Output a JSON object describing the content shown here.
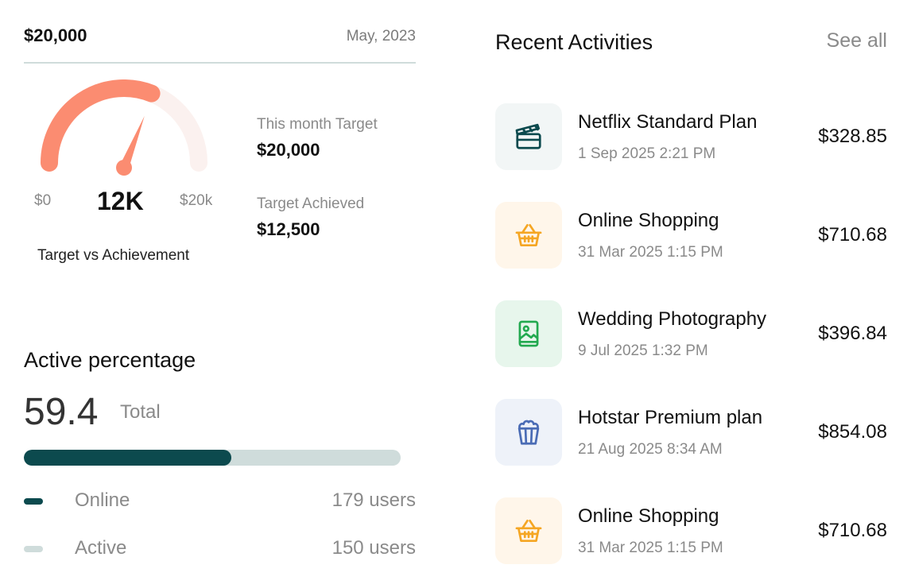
{
  "target": {
    "amount": "$20,000",
    "date": "May, 2023",
    "gauge": {
      "min_label": "$0",
      "max_label": "$20k",
      "value_label": "12K",
      "caption": "Target vs Achievement",
      "progress_fraction": 0.62,
      "color_progress": "#fb8c71",
      "color_remaining": "#fbf1ef"
    },
    "month_target_label": "This month Target",
    "month_target_value": "$20,000",
    "achieved_label": "Target Achieved",
    "achieved_value": "$12,500"
  },
  "active": {
    "title": "Active percentage",
    "value": "59.4",
    "total_label": "Total",
    "bar_fill_percent": 55,
    "legend": [
      {
        "label": "Online",
        "count": "179 users",
        "color": "#0c4a4e"
      },
      {
        "label": "Active",
        "count": "150 users",
        "color": "#cfdcdb"
      }
    ]
  },
  "recent": {
    "title": "Recent Activities",
    "see_all": "See all",
    "items": [
      {
        "name": "Netflix Standard Plan",
        "time": "1 Sep 2025 2:21 PM",
        "amount": "$328.85",
        "icon": "clapperboard-icon",
        "bg": "#f2f6f6",
        "fg": "#0c4a4e"
      },
      {
        "name": "Online Shopping",
        "time": "31 Mar 2025 1:15 PM",
        "amount": "$710.68",
        "icon": "basket-icon",
        "bg": "#fff6ea",
        "fg": "#f5a623"
      },
      {
        "name": "Wedding Photography",
        "time": "9 Jul 2025 1:32 PM",
        "amount": "$396.84",
        "icon": "image-icon",
        "bg": "#e7f6ec",
        "fg": "#22a94f"
      },
      {
        "name": "Hotstar Premium plan",
        "time": "21 Aug 2025 8:34 AM",
        "amount": "$854.08",
        "icon": "popcorn-icon",
        "bg": "#eef2f9",
        "fg": "#4a6cb5"
      },
      {
        "name": "Online Shopping",
        "time": "31 Mar 2025 1:15 PM",
        "amount": "$710.68",
        "icon": "basket-icon",
        "bg": "#fff6ea",
        "fg": "#f5a623"
      }
    ]
  }
}
